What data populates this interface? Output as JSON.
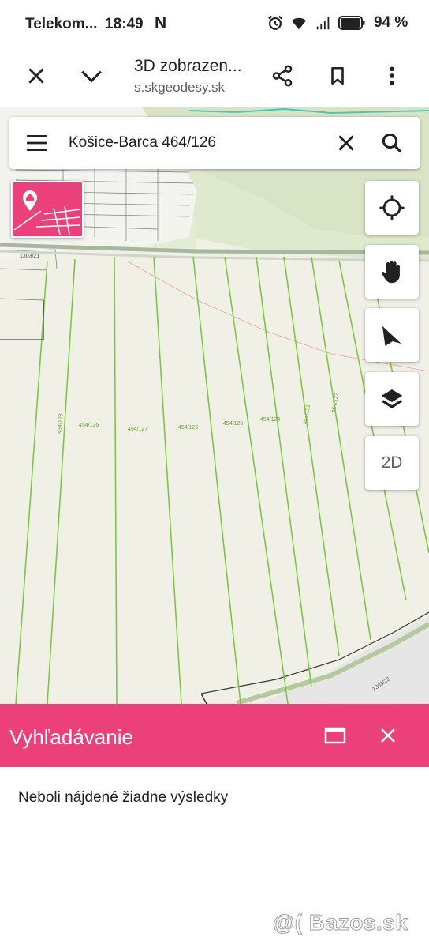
{
  "status_bar": {
    "carrier": "Telekom...",
    "time": "18:49",
    "notif_letter": "N",
    "battery": "94 %",
    "icons": [
      "alarm-icon",
      "wifi-icon",
      "signal-icon",
      "battery-icon"
    ]
  },
  "toolbar": {
    "title": "3D zobrazen...",
    "url": "s.skgeodesy.sk",
    "icons": [
      "close-icon",
      "chevron-down-icon",
      "share-icon",
      "bookmark-icon",
      "more-vert-icon"
    ]
  },
  "search": {
    "query": "Košice-Barca 464/126"
  },
  "map": {
    "parcel_labels": [
      "454/128",
      "454/126",
      "454/127",
      "454/126",
      "454/125",
      "454/124",
      "454/121",
      "454/122",
      "1303/21",
      "1303/22"
    ],
    "mode_button": "2D"
  },
  "panel": {
    "title": "Vyhľadávanie",
    "message": "Neboli nájdené žiadne výsledky"
  },
  "watermark": "@( Bazos.sk",
  "colors": {
    "accent": "#ec407a",
    "map_background": "#f1f0e6",
    "parcel_lines": "#7cc742"
  }
}
